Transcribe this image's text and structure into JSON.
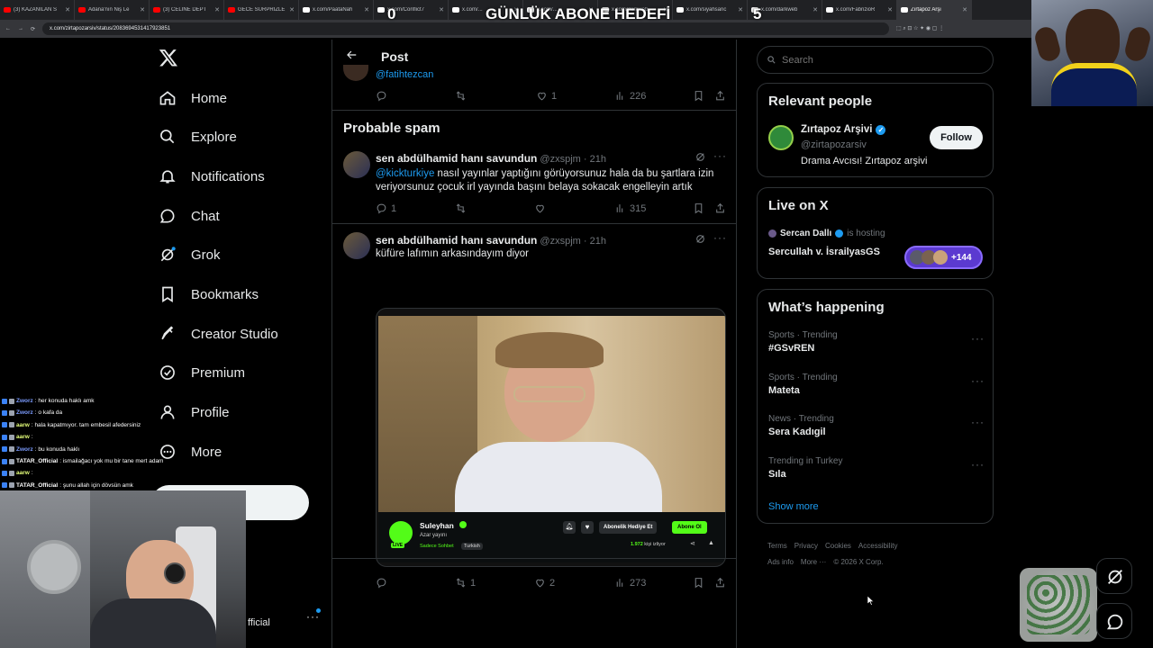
{
  "browser": {
    "tabs": [
      {
        "label": "(3) KAZANILAN S",
        "color": "#ff0000"
      },
      {
        "label": "Adana'nın Niş Le",
        "color": "#ff0000"
      },
      {
        "label": "(3) CELİNE DEPT",
        "color": "#ff0000"
      },
      {
        "label": "GECE SÜRPRİZLE",
        "color": "#ff0000"
      },
      {
        "label": "x.com/PaataNah",
        "color": "#ffffff"
      },
      {
        "label": "x.com/Conflict7",
        "color": "#ffffff"
      },
      {
        "label": "x.com/...",
        "color": "#ffffff"
      },
      {
        "label": "x.com/...",
        "color": "#ffffff"
      },
      {
        "label": "x.com/darkweb",
        "color": "#ffffff"
      },
      {
        "label": "x.com/siyahsanc",
        "color": "#ffffff"
      },
      {
        "label": "x.com/darkweb",
        "color": "#ffffff"
      },
      {
        "label": "x.com/FabrizioR",
        "color": "#ffffff"
      },
      {
        "label": "Zırtapoz Arşi",
        "color": "#ffffff"
      }
    ],
    "url": "x.com/zirtapozarsiv/status/2083694531417923851"
  },
  "overlay": {
    "left_number": "0",
    "title": "GÜNLÜK ABONE HEDEFİ",
    "right_number": "5"
  },
  "sidebar": {
    "items": [
      {
        "label": "Home",
        "icon": "home-icon"
      },
      {
        "label": "Explore",
        "icon": "search-icon"
      },
      {
        "label": "Notifications",
        "icon": "bell-icon"
      },
      {
        "label": "Chat",
        "icon": "chat-icon"
      },
      {
        "label": "Grok",
        "icon": "grok-icon"
      },
      {
        "label": "Bookmarks",
        "icon": "bookmark-icon"
      },
      {
        "label": "Creator Studio",
        "icon": "rocket-icon"
      },
      {
        "label": "Premium",
        "icon": "verified-icon"
      },
      {
        "label": "Profile",
        "icon": "person-icon"
      },
      {
        "label": "More",
        "icon": "more-icon"
      }
    ],
    "account_suffix": "fficial"
  },
  "main": {
    "header_title": "Post",
    "top_reply": {
      "handle": "@fatihtezcan",
      "views": "226",
      "likes": "1"
    },
    "section_title": "Probable spam",
    "tweets": [
      {
        "name": "sen abdülhamid hanı savundun",
        "handle": "@zxspjm",
        "time": "· 21h",
        "mention": "@kickturkiye",
        "text": " nasıl yayınlar yaptığını görüyorsunuz hala da bu şartlara izin veriyorsunuz çocuk irl yayında başını belaya sokacak engelleyin artık",
        "replies": "1",
        "retweets": "",
        "likes": "",
        "views": "315"
      },
      {
        "name": "sen abdülhamid hanı savundun",
        "handle": "@zxspjm",
        "time": "· 21h",
        "text": "küfüre lafımın arkasındayım diyor",
        "replies": "",
        "retweets": "1",
        "likes": "2",
        "views": "273",
        "embed": {
          "streamer": "Suleyhan",
          "subtitle": "Azar yayını",
          "tag1": "Sadece Sohbet",
          "tag2": "Turkish",
          "gift_btn": "Abonelik Hediye Et",
          "sub_btn": "Abone Ol",
          "viewers": "1.972",
          "viewers_label": "kişi izliyor",
          "live_badge": "LIVE"
        }
      }
    ]
  },
  "right": {
    "search_placeholder": "Search",
    "relevant": {
      "title": "Relevant people",
      "name": "Zırtapoz Arşivi",
      "handle": "@zirtapozarsiv",
      "bio": "Drama Avcısı! Zırtapoz arşivi",
      "follow": "Follow"
    },
    "live": {
      "title": "Live on X",
      "host": "Sercan Dallı",
      "hosting": "is hosting",
      "space": "Sercullah v. İsrailyasGS",
      "count": "+144"
    },
    "happening": {
      "title": "What’s happening",
      "trends": [
        {
          "meta": "Sports · Trending",
          "name": "#GSvREN"
        },
        {
          "meta": "Sports · Trending",
          "name": "Mateta"
        },
        {
          "meta": "News · Trending",
          "name": "Sera Kadıgil"
        },
        {
          "meta": "Trending in Turkey",
          "name": "Sıla"
        }
      ],
      "show_more": "Show more"
    },
    "footer": [
      "Terms",
      "Privacy",
      "Cookies",
      "Accessibility",
      "Ads info",
      "More ···",
      "© 2026 X Corp."
    ]
  },
  "chat": [
    {
      "user": "Zworz",
      "msg": ": her konuda haklı amk",
      "color": "#7c9cff"
    },
    {
      "user": "Zworz",
      "msg": ": o kafa da",
      "color": "#7c9cff"
    },
    {
      "user": "aarw",
      "msg": ": hala kapatmıyor. tam embesil afedersiniz",
      "color": "#e5ff7a"
    },
    {
      "user": "aarw",
      "msg": ":",
      "color": "#e5ff7a"
    },
    {
      "user": "Zworz",
      "msg": ": bu konuda haklı",
      "color": "#7c9cff"
    },
    {
      "user": "TATAR_Official",
      "msg": ": ismailağacı yok mu bir tane mert adam",
      "color": "#ffffff"
    },
    {
      "user": "aarw",
      "msg": ":",
      "color": "#e5ff7a"
    },
    {
      "user": "TATAR_Official",
      "msg": ": şunu allah için dövsün amk",
      "color": "#ffffff"
    }
  ]
}
